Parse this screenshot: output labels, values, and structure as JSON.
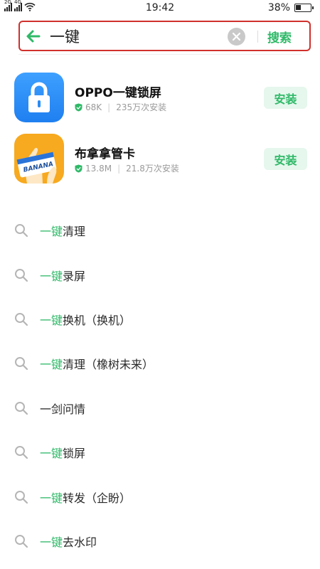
{
  "status_bar": {
    "signal1_label": "2G",
    "signal2_label": "4G",
    "time": "19:42",
    "battery": "38%",
    "battery_level": 0.38
  },
  "search": {
    "query": "一键",
    "submit_label": "搜索"
  },
  "apps": [
    {
      "name": "OPPO一键锁屏",
      "size": "68K",
      "installs": "235万次安装",
      "install_label": "安装"
    },
    {
      "name": "布拿拿管卡",
      "size": "13.8M",
      "installs": "21.8万次安装",
      "install_label": "安装"
    }
  ],
  "suggestions": [
    {
      "highlight": "一键",
      "rest": "清理"
    },
    {
      "highlight": "一键",
      "rest": "录屏"
    },
    {
      "highlight": "一键",
      "rest": "换机（换机）"
    },
    {
      "highlight": "一键",
      "rest": "清理（橡树未来）"
    },
    {
      "highlight": "",
      "rest": "一剑问情"
    },
    {
      "highlight": "一键",
      "rest": "锁屏"
    },
    {
      "highlight": "一键",
      "rest": "转发（企盼）"
    },
    {
      "highlight": "一键",
      "rest": "去水印"
    }
  ],
  "icon_text": {
    "banana_card": "BANANA"
  },
  "colors": {
    "accent": "#2fb968",
    "highlight_border": "#d0302c",
    "install_bg": "#e6f7ed"
  }
}
